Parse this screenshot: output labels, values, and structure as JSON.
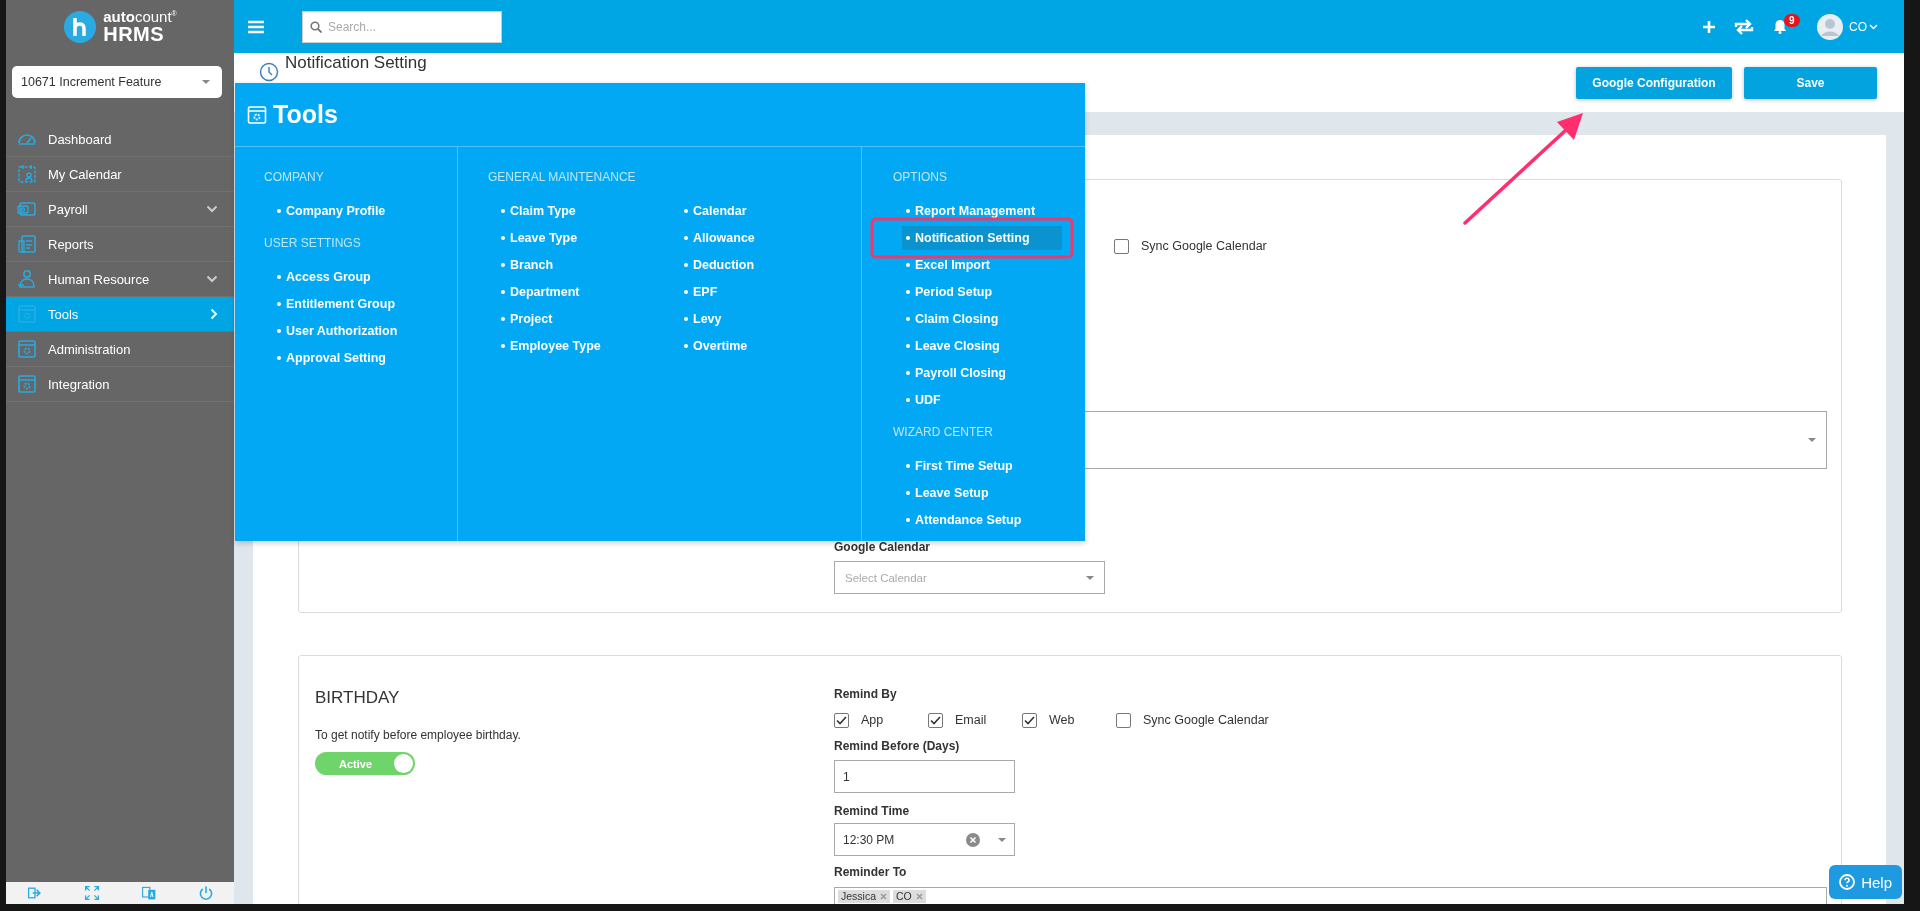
{
  "sidebar": {
    "logo": {
      "brand": "**auto**count$^{®}$",
      "product": "HRMS"
    },
    "company_select": {
      "value": "10671 Increment Feature"
    },
    "items": [
      {
        "label": "Dashboard",
        "kind": "gauge",
        "expandable": false,
        "selected": false
      },
      {
        "label": "My Calendar",
        "kind": "calendar",
        "expandable": false,
        "selected": false
      },
      {
        "label": "Payroll",
        "kind": "payroll",
        "expandable": true,
        "selected": false
      },
      {
        "label": "Reports",
        "kind": "report",
        "expandable": false,
        "selected": false
      },
      {
        "label": "Human Resource",
        "kind": "person",
        "expandable": true,
        "selected": false
      },
      {
        "label": "Tools",
        "kind": "tools",
        "expandable": true,
        "selected": true
      },
      {
        "label": "Administration",
        "kind": "tools",
        "expandable": false,
        "selected": false
      },
      {
        "label": "Integration",
        "kind": "tools",
        "expandable": false,
        "selected": false
      }
    ],
    "footer_buttons": [
      {
        "kind": "logout"
      },
      {
        "kind": "fullscreen"
      },
      {
        "kind": "language"
      },
      {
        "kind": "power"
      }
    ]
  },
  "topbar": {
    "search": {
      "placeholder": "Search..."
    },
    "notification_count": "9",
    "user": "CO"
  },
  "page_header": {
    "title": "Notification Setting",
    "buttons": [
      "Google Configuration",
      "Save"
    ]
  },
  "cards": [
    {
      "sync": {
        "label": "Sync Google Calendar",
        "checked": false
      },
      "google_calendar": {
        "label": "Google Calendar",
        "placeholder": "Select Calendar"
      }
    },
    {
      "title": "BIRTHDAY",
      "description": "To get notify before employee birthday.",
      "toggle": {
        "label": "Active",
        "on": true
      },
      "remind_by": {
        "label": "Remind By",
        "options": [
          {
            "label": "App",
            "checked": true
          },
          {
            "label": "Email",
            "checked": true
          },
          {
            "label": "Web",
            "checked": true
          },
          {
            "label": "Sync Google Calendar",
            "checked": false
          }
        ]
      },
      "remind_before": {
        "label": "Remind Before (Days)",
        "value": "1"
      },
      "remind_time": {
        "label": "Remind Time",
        "value": "12:30 PM"
      },
      "reminder_to": {
        "label": "Reminder To",
        "tags": [
          "Jessica",
          "CO"
        ]
      }
    }
  ],
  "tools_menu": {
    "title": "Tools",
    "columns": [
      {
        "sections": [
          {
            "heading": "COMPANY",
            "lists": [
              {
                "items": [
                  {
                    "label": "Company Profile",
                    "selected": false
                  }
                ]
              }
            ]
          },
          {
            "heading": "USER SETTINGS",
            "lists": [
              {
                "items": [
                  {
                    "label": "Access Group",
                    "selected": false
                  },
                  {
                    "label": "Entitlement Group",
                    "selected": false
                  },
                  {
                    "label": "User Authorization",
                    "selected": false
                  },
                  {
                    "label": "Approval Setting",
                    "selected": false
                  }
                ]
              }
            ]
          }
        ]
      },
      {
        "sections": [
          {
            "heading": "GENERAL MAINTENANCE",
            "lists": [
              {
                "items": [
                  {
                    "label": "Claim Type",
                    "selected": false
                  },
                  {
                    "label": "Leave Type",
                    "selected": false
                  },
                  {
                    "label": "Branch",
                    "selected": false
                  },
                  {
                    "label": "Department",
                    "selected": false
                  },
                  {
                    "label": "Project",
                    "selected": false
                  },
                  {
                    "label": "Employee Type",
                    "selected": false
                  }
                ]
              },
              {
                "items": [
                  {
                    "label": "Calendar",
                    "selected": false
                  },
                  {
                    "label": "Allowance",
                    "selected": false
                  },
                  {
                    "label": "Deduction",
                    "selected": false
                  },
                  {
                    "label": "EPF",
                    "selected": false
                  },
                  {
                    "label": "Levy",
                    "selected": false
                  },
                  {
                    "label": "Overtime",
                    "selected": false
                  }
                ]
              }
            ]
          }
        ]
      },
      {
        "sections": [
          {
            "heading": "OPTIONS",
            "lists": [
              {
                "items": [
                  {
                    "label": "Report Management",
                    "selected": false
                  },
                  {
                    "label": "Notification Setting",
                    "selected": true
                  },
                  {
                    "label": "Excel Import",
                    "selected": false
                  },
                  {
                    "label": "Period Setup",
                    "selected": false
                  },
                  {
                    "label": "Claim Closing",
                    "selected": false
                  },
                  {
                    "label": "Leave Closing",
                    "selected": false
                  },
                  {
                    "label": "Payroll Closing",
                    "selected": false
                  },
                  {
                    "label": "UDF",
                    "selected": false
                  }
                ]
              }
            ]
          },
          {
            "heading": "WIZARD CENTER",
            "lists": [
              {
                "items": [
                  {
                    "label": "First Time Setup",
                    "selected": false
                  },
                  {
                    "label": "Leave Setup",
                    "selected": false
                  },
                  {
                    "label": "Attendance Setup",
                    "selected": false
                  }
                ]
              }
            ]
          }
        ]
      }
    ]
  },
  "help_button": {
    "label": "Help"
  }
}
